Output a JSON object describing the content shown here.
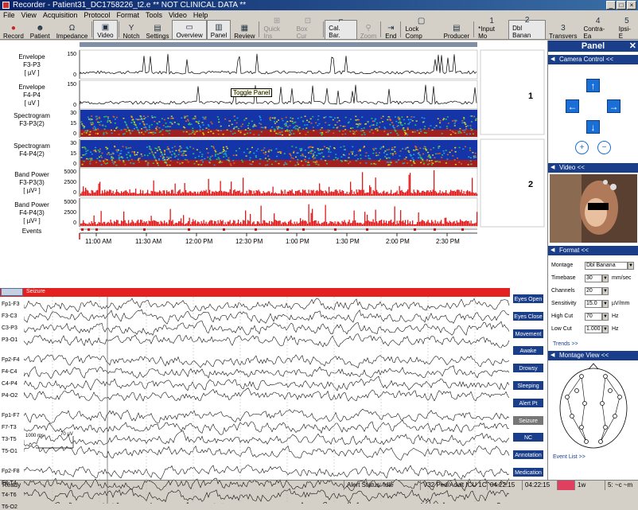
{
  "window": {
    "title": "Recorder - Patient31_DC1758226_t2.e ** NOT CLINICAL DATA **"
  },
  "menu": [
    "File",
    "View",
    "Acquisition",
    "Protocol",
    "Format",
    "Tools",
    "Video",
    "Help"
  ],
  "toolbar": [
    {
      "label": "Record",
      "icon": "record-icon",
      "glyph": "●",
      "state": "normal"
    },
    {
      "label": "Patient",
      "icon": "patient-icon",
      "glyph": "☻",
      "state": "normal"
    },
    {
      "label": "Impedance",
      "icon": "impedance-icon",
      "glyph": "Ω",
      "state": "normal"
    },
    {
      "label": "Video",
      "icon": "video-icon",
      "glyph": "▣",
      "state": "selected"
    },
    {
      "label": "Notch",
      "icon": "notch-icon",
      "glyph": "Y",
      "state": "normal"
    },
    {
      "label": "Settings",
      "icon": "settings-icon",
      "glyph": "▤",
      "state": "normal"
    },
    {
      "label": "Overview",
      "icon": "overview-icon",
      "glyph": "▭",
      "state": "selected"
    },
    {
      "label": "Panel",
      "icon": "panel-icon",
      "glyph": "▥",
      "state": "selected"
    },
    {
      "label": "Review",
      "icon": "review-icon",
      "glyph": "▦",
      "state": "normal"
    },
    {
      "label": "Quick Ins",
      "icon": "quick-ins-icon",
      "glyph": "⊞",
      "state": "disabled"
    },
    {
      "label": "Box Cur",
      "icon": "box-cursor-icon",
      "glyph": "⊡",
      "state": "disabled"
    },
    {
      "label": "Cal. Bar.",
      "icon": "cal-bar-icon",
      "glyph": "⌐",
      "state": "selected"
    },
    {
      "label": "Zoom",
      "icon": "zoom-icon",
      "glyph": "⚲",
      "state": "disabled"
    },
    {
      "label": "End",
      "icon": "end-icon",
      "glyph": "⇥",
      "state": "normal"
    },
    {
      "label": "Lock Comp",
      "icon": "lock-comp-icon",
      "glyph": "▢",
      "state": "normal"
    },
    {
      "label": "Producer",
      "icon": "producer-icon",
      "glyph": "▤",
      "state": "normal"
    },
    {
      "label": "*Input Mo",
      "icon": "num-1",
      "glyph": "1",
      "state": "normal"
    },
    {
      "label": "Dbl Banan",
      "icon": "num-2",
      "glyph": "2",
      "state": "selected"
    },
    {
      "label": "Transvers",
      "icon": "num-3",
      "glyph": "3",
      "state": "normal"
    },
    {
      "label": "Contra-Ea",
      "icon": "num-4",
      "glyph": "4",
      "state": "normal"
    },
    {
      "label": "Ipsi-E",
      "icon": "num-5",
      "glyph": "5",
      "state": "normal"
    }
  ],
  "tooltip": "Toggle Panel",
  "trends": [
    {
      "name": "Envelope",
      "channel": "F3-P3",
      "unit": "[ µV ]",
      "ticks": [
        "150",
        "0"
      ]
    },
    {
      "name": "Envelope",
      "channel": "F4-P4",
      "unit": "[ uV ]",
      "ticks": [
        "150",
        "0"
      ]
    },
    {
      "name": "Spectrogram",
      "channel": "F3-P3(2)",
      "unit": "",
      "ticks": [
        "30",
        "15",
        "0"
      ]
    },
    {
      "name": "Spectrogram",
      "channel": "F4-P4(2)",
      "unit": "",
      "ticks": [
        "30",
        "15",
        "0"
      ]
    },
    {
      "name": "Band Power",
      "channel": "F3-P3(3)",
      "unit": "[ µV² ]",
      "ticks": [
        "5000",
        "2500",
        "0"
      ]
    },
    {
      "name": "Band Power",
      "channel": "F4-P4(3)",
      "unit": "[ µV² ]",
      "ticks": [
        "5000",
        "2500",
        "0"
      ]
    }
  ],
  "events_label": "Events",
  "group_numbers": [
    "1",
    "2"
  ],
  "time_labels": [
    "11:00 AM",
    "11:30 AM",
    "12:00 PM",
    "12:30 PM",
    "1:00 PM",
    "1:30 PM",
    "2:00 PM",
    "2:30 PM"
  ],
  "eeg": {
    "event_marker": "Seizure",
    "channels": [
      "Fp1-F3",
      "F3-C3",
      "C3-P3",
      "P3-O1",
      "Fp2-F4",
      "F4-C4",
      "C4-P4",
      "P4-O2",
      "Fp1-F7",
      "F7-T3",
      "T3-T5",
      "T5-O1",
      "Fp2-F8",
      "F8-T4",
      "T4-T6",
      "T6-O2"
    ],
    "cal_time": "1000 ms",
    "cal_amp": "70 µV"
  },
  "event_buttons": [
    "Eyes Open",
    "Eyes Close",
    "Movement",
    "Awake",
    "Drowsy",
    "Sleeping",
    "Alert Pt",
    "Seizure",
    "NC",
    "Annotation",
    "Medication"
  ],
  "panel": {
    "title": "Panel",
    "camera_control": "Camera Control <<",
    "video": "Video <<",
    "format": "Format <<",
    "montage_label": "Montage",
    "montage_value": "Dbl Banana",
    "timebase_label": "Timebase",
    "timebase_value": "30",
    "timebase_unit": "mm/sec",
    "channels_label": "Channels",
    "channels_value": "20",
    "sensitivity_label": "Sensitivity",
    "sensitivity_value": "15.0",
    "sensitivity_unit": "µV/mm",
    "highcut_label": "High Cut",
    "highcut_value": "70",
    "highcut_unit": "Hz",
    "lowcut_label": "Low Cut",
    "lowcut_value": "1.000",
    "lowcut_unit": "Hz",
    "trends_link": "Trends >>",
    "montage_view": "Montage View <<",
    "event_list": "Event List >>"
  },
  "status": {
    "ready": "Ready",
    "alert": "Alert Status: Idle",
    "device": "V32 Ped/Adult ICU 1C",
    "time1": "04:22:15",
    "time2": "04:22:15",
    "zoom": "1w",
    "scale": "5: ~c ~m"
  }
}
